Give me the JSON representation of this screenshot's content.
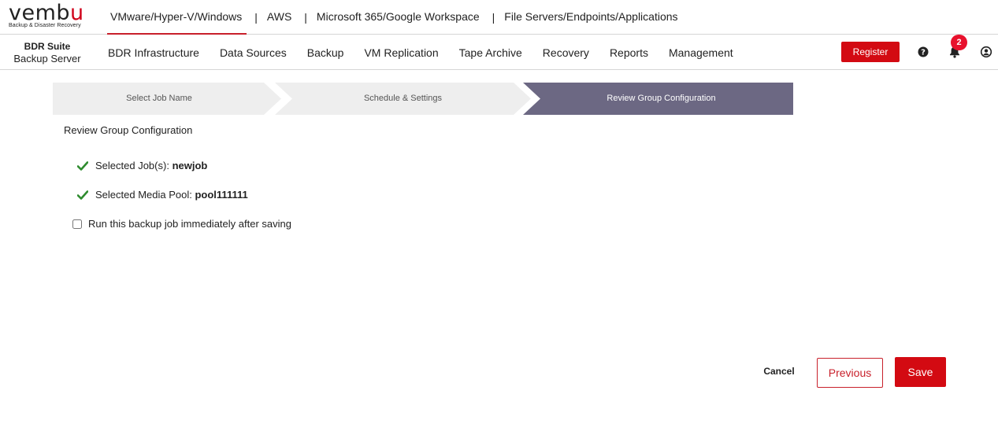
{
  "logo": {
    "word_prefix": "vemb",
    "word_suffix": "u",
    "tagline": "Backup & Disaster Recovery"
  },
  "top_tabs": [
    {
      "label": "VMware/Hyper-V/Windows",
      "active": true
    },
    {
      "label": "AWS",
      "active": false
    },
    {
      "label": "Microsoft 365/Google Workspace",
      "active": false
    },
    {
      "label": "File Servers/Endpoints/Applications",
      "active": false
    }
  ],
  "separator": "|",
  "brand": {
    "line1": "BDR Suite",
    "line2": "Backup Server"
  },
  "nav": {
    "items": [
      "BDR Infrastructure",
      "Data Sources",
      "Backup",
      "VM Replication",
      "Tape Archive",
      "Recovery",
      "Reports",
      "Management"
    ],
    "register_label": "Register",
    "notification_count": "2",
    "icons": {
      "help": "help-icon",
      "bell": "bell-icon",
      "user": "user-icon"
    }
  },
  "stepper": {
    "steps": [
      "Select Job Name",
      "Schedule & Settings",
      "Review Group Configuration"
    ],
    "active_index": 2
  },
  "review": {
    "title": "Review Group Configuration",
    "jobs_label": "Selected Job(s):",
    "jobs_value": "newjob",
    "pool_label": "Selected Media Pool:",
    "pool_value": "pool111111",
    "run_label": "Run this backup job immediately after saving",
    "run_checked": false
  },
  "footer": {
    "cancel_label": "Cancel",
    "previous_label": "Previous",
    "save_label": "Save"
  },
  "colors": {
    "accent": "#d30a12",
    "active_step": "#6c6883",
    "check": "#2e8b2e"
  }
}
